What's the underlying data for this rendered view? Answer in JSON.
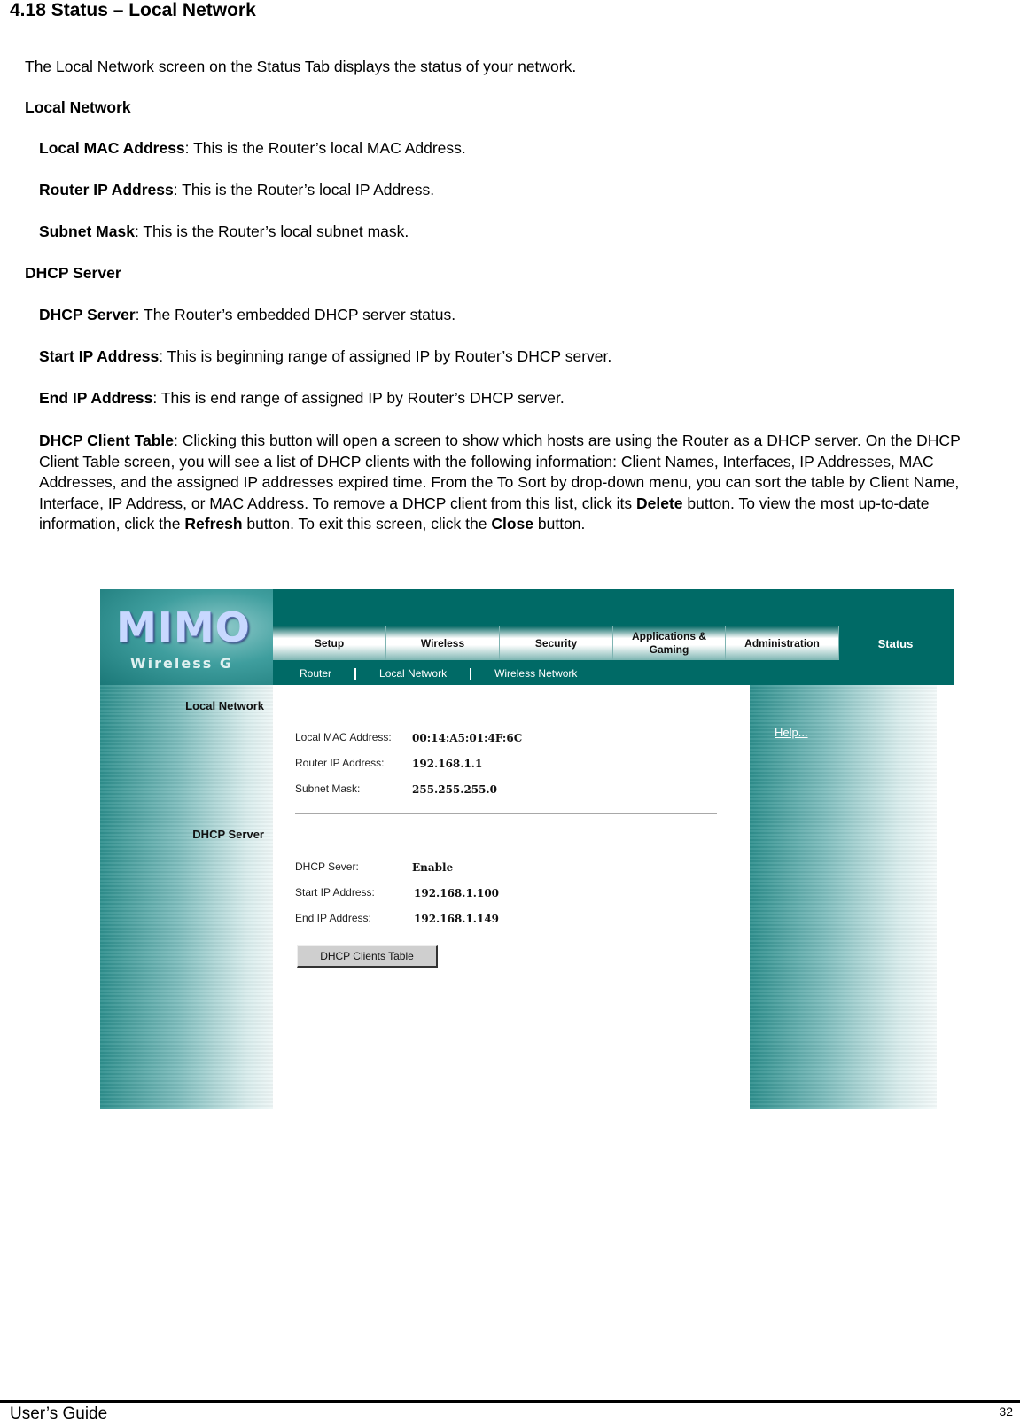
{
  "document": {
    "heading": "4.18 Status – Local Network",
    "intro": "The Local Network screen on the Status Tab displays the status of your network.",
    "sections": [
      {
        "title": "Local Network",
        "items": [
          {
            "term": "Local MAC Address",
            "desc": ": This is the Router’s local MAC Address."
          },
          {
            "term": "Router IP Address",
            "desc": ": This is the Router’s local IP Address."
          },
          {
            "term": "Subnet Mask",
            "desc": ": This is the Router’s local subnet mask."
          }
        ]
      },
      {
        "title": "DHCP Server",
        "items": [
          {
            "term": "DHCP Server",
            "desc": ": The Router’s embedded DHCP server status."
          },
          {
            "term": "Start IP Address",
            "desc": ": This is beginning range of assigned IP by Router’s DHCP server."
          },
          {
            "term": "End IP Address",
            "desc": ": This is end range of assigned IP by Router’s DHCP server."
          }
        ]
      }
    ],
    "client_table_para": {
      "term": "DHCP Client Table",
      "part1": ": Clicking this button will open a screen to show which hosts are using the Router as a DHCP server. On the DHCP Client Table screen, you will see a list of DHCP clients  with the following information: Client Names, Interfaces, IP Addresses, MAC Addresses, and the assigned IP addresses expired time. From the To Sort by drop-down menu, you can sort the table by Client Name, Interface, IP Address, or MAC Address. To remove a DHCP client from this list, click its ",
      "delete": "Delete",
      "part2": " button. To view the most up-to-date information, click the ",
      "refresh": "Refresh",
      "part3": " button. To exit this screen, click the ",
      "close": "Close",
      "part4": " button."
    }
  },
  "router_ui": {
    "logo": {
      "main": "MIMO",
      "sub": "Wireless G"
    },
    "tabs": [
      {
        "label": "Setup"
      },
      {
        "label": "Wireless"
      },
      {
        "label": "Security"
      },
      {
        "label": "Applications & Gaming"
      },
      {
        "label": "Administration"
      },
      {
        "label": "Status",
        "active": true
      }
    ],
    "subnav": [
      "Router",
      "Local Network",
      "Wireless Network"
    ],
    "left_labels": {
      "local_network": "Local Network",
      "dhcp_server": "DHCP Server"
    },
    "help_link": "Help...",
    "local_network": [
      {
        "label": "Local MAC Address:",
        "value": "00:14:A5:01:4F:6C"
      },
      {
        "label": "Router IP Address:",
        "value": "192.168.1.1"
      },
      {
        "label": "Subnet Mask:",
        "value": "255.255.255.0"
      }
    ],
    "dhcp": [
      {
        "label": "DHCP Sever:",
        "value": "Enable"
      },
      {
        "label": "Start IP Address:",
        "value": "192.168.1.100"
      },
      {
        "label": "End IP Address:",
        "value": "192.168.1.149"
      }
    ],
    "dhcp_button": "DHCP Clients Table",
    "colors": {
      "brand_teal": "#006a66"
    }
  },
  "footer": {
    "left": "User’s Guide",
    "page": "32"
  }
}
